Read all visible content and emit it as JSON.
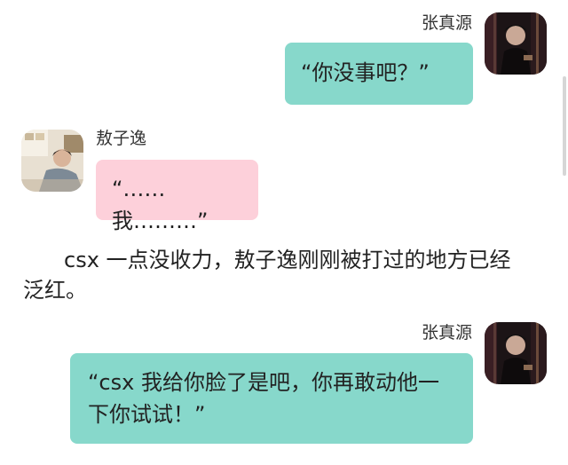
{
  "messages": [
    {
      "speaker": "张真源",
      "side": "right",
      "avatar_icon": "male-avatar-dark-photo",
      "bubble_color": "#87d8cb",
      "text": "“你没事吧？”"
    },
    {
      "speaker": "敖子逸",
      "side": "left",
      "avatar_icon": "male-avatar-bright-photo",
      "bubble_color": "#fdd0da",
      "text": "“……我………”"
    },
    {
      "speaker": "张真源",
      "side": "right",
      "avatar_icon": "male-avatar-dark-photo",
      "bubble_color": "#87d8cb",
      "text": "“csx 我给你脸了是吧，你再敢动他一下你试试！”"
    }
  ],
  "narration": "csx 一点没收力，敖子逸刚刚被打过的地方已经泛红。"
}
